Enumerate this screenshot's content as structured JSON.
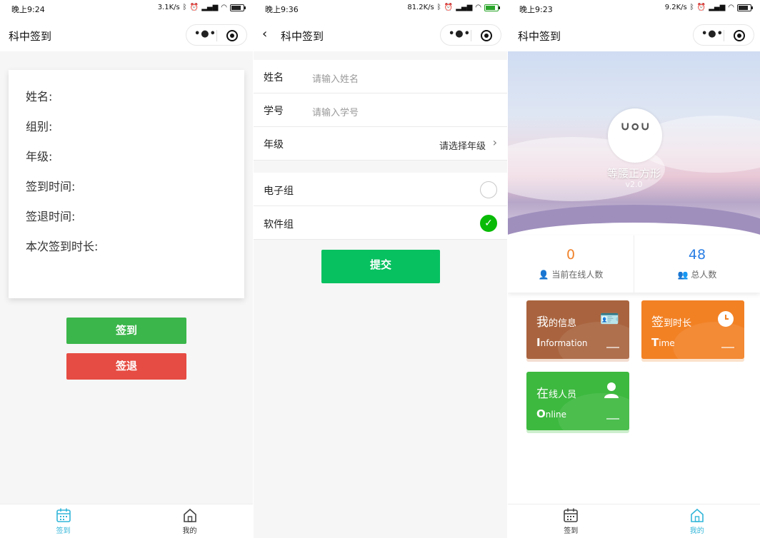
{
  "screen1": {
    "status": {
      "time": "晚上9:24",
      "speed": "3.1K/s"
    },
    "nav_title": "科中签到",
    "info_lines": [
      "姓名:",
      "组别:",
      "年级:",
      "签到时间:",
      "签退时间:",
      "本次签到时长:"
    ],
    "signin_label": "签到",
    "signout_label": "签退",
    "tabs": [
      {
        "label": "签到",
        "icon": "calendar-icon",
        "active": true
      },
      {
        "label": "我的",
        "icon": "home-icon",
        "active": false
      }
    ]
  },
  "screen2": {
    "status": {
      "time": "晚上9:36",
      "speed": "81.2K/s"
    },
    "nav_title": "科中签到",
    "fields": [
      {
        "label": "姓名",
        "placeholder": "请输入姓名"
      },
      {
        "label": "学号",
        "placeholder": "请输入学号"
      }
    ],
    "grade": {
      "label": "年级",
      "value": "请选择年级"
    },
    "groups": [
      {
        "label": "电子组",
        "checked": false
      },
      {
        "label": "软件组",
        "checked": true
      }
    ],
    "submit_label": "提交"
  },
  "screen3": {
    "status": {
      "time": "晚上9:23",
      "speed": "9.2K/s"
    },
    "nav_title": "科中签到",
    "user_name": "等腰正方形",
    "version": "v2.0",
    "stats": [
      {
        "value": "0",
        "caption": "当前在线人数",
        "color": "#f0832c"
      },
      {
        "value": "48",
        "caption": "总人数",
        "color": "#2a7ee5"
      }
    ],
    "tiles": [
      {
        "big": "我",
        "rest": "的信息",
        "sub_big": "I",
        "sub_rest": "nformation",
        "icon": "id-card-icon",
        "color": "#a9643f"
      },
      {
        "big": "签",
        "rest": "到时长",
        "sub_big": "T",
        "sub_rest": "ime",
        "icon": "clock-icon",
        "color": "#f28124"
      },
      {
        "big": "在",
        "rest": "线人员",
        "sub_big": "O",
        "sub_rest": "nline",
        "icon": "person-icon",
        "color": "#3db93f"
      }
    ],
    "tabs": [
      {
        "label": "签到",
        "icon": "calendar-icon",
        "active": false
      },
      {
        "label": "我的",
        "icon": "home-icon",
        "active": true
      }
    ]
  }
}
